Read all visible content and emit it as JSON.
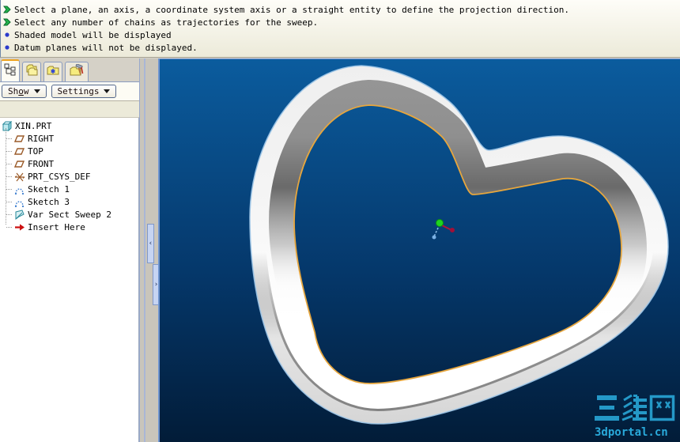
{
  "message_bar": {
    "messages": [
      {
        "icon": "prompt-arrow-icon",
        "text": "Select a plane, an axis, a coordinate system axis or a straight entity to define the projection direction."
      },
      {
        "icon": "prompt-arrow-icon",
        "text": "Select any number of chains as trajectories for the sweep."
      },
      {
        "icon": "info-bullet-icon",
        "text": "Shaded model will be displayed"
      },
      {
        "icon": "info-bullet-icon",
        "text": "Datum planes will not be displayed."
      }
    ]
  },
  "navigator": {
    "tabs": [
      {
        "name": "model-tree",
        "icon": "model-tree-icon",
        "active": true
      },
      {
        "name": "layer-tree",
        "icon": "layer-folders-icon",
        "active": false
      },
      {
        "name": "folder-browser",
        "icon": "folder-star-icon",
        "active": false
      },
      {
        "name": "utilities",
        "icon": "folder-tools-icon",
        "active": false
      }
    ],
    "toolbar": {
      "show_label_pre": "Sh",
      "show_label_key": "o",
      "show_label_post": "w",
      "settings_label": "Settings",
      "dropdown_glyph": "▼"
    }
  },
  "model_tree": {
    "items": [
      {
        "label": "XIN.PRT",
        "icon": "part-icon",
        "level": 0
      },
      {
        "label": "RIGHT",
        "icon": "datum-plane-icon",
        "level": 1
      },
      {
        "label": "TOP",
        "icon": "datum-plane-icon",
        "level": 1
      },
      {
        "label": "FRONT",
        "icon": "datum-plane-icon",
        "level": 1
      },
      {
        "label": "PRT_CSYS_DEF",
        "icon": "csys-icon",
        "level": 1
      },
      {
        "label": "Sketch 1",
        "icon": "sketch-icon",
        "level": 1
      },
      {
        "label": "Sketch 3",
        "icon": "sketch-icon",
        "level": 1
      },
      {
        "label": "Var Sect Sweep 2",
        "icon": "sweep-icon",
        "level": 1
      },
      {
        "label": "Insert Here",
        "icon": "insert-here-icon",
        "level": 1
      }
    ]
  },
  "splitter": {
    "collapse_left_glyph": "‹",
    "collapse_right_glyph": "›"
  },
  "viewport": {
    "background_top": "#0b5c9e",
    "background_mid": "#05386b",
    "background_bottom": "#021c38",
    "model": {
      "face_color": "#f2f2f2",
      "inner_edge_color": "#e6a63e",
      "silhouette_color": "#9fc6e8"
    },
    "csys_triad_colors": {
      "green": "#1fd41f",
      "red": "#b5103c",
      "blue": "#7ab2e6"
    }
  },
  "watermark": {
    "cjk_text": "三维网",
    "latin_text": "3dportal.cn",
    "color": "#2db5e8"
  }
}
